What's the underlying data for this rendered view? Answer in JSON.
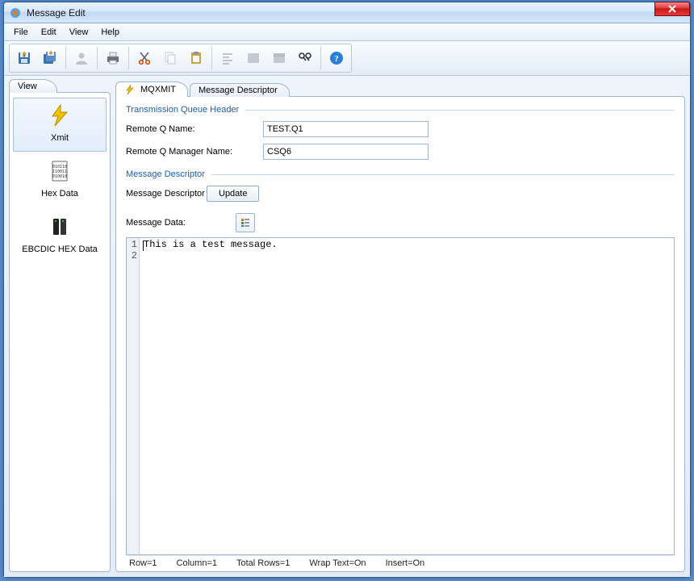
{
  "title": "Message Edit",
  "menu": {
    "file": "File",
    "edit": "Edit",
    "view": "View",
    "help": "Help"
  },
  "toolbar": {
    "save": "save-icon",
    "save_all": "save-all-icon",
    "user": "user-icon",
    "print": "print-icon",
    "cut": "cut-icon",
    "copy": "copy-icon",
    "paste": "paste-icon",
    "dedent": "dedent-icon",
    "block1": "block-icon",
    "block2": "block-icon",
    "find": "find-icon",
    "help": "help-icon"
  },
  "side": {
    "tab": "View",
    "items": [
      {
        "id": "xmit",
        "label": "Xmit"
      },
      {
        "id": "hex",
        "label": "Hex Data"
      },
      {
        "id": "ebcdic",
        "label": "EBCDIC HEX Data"
      }
    ]
  },
  "tabs": {
    "mqxmit": "MQXMIT",
    "msgdesc": "Message Descriptor"
  },
  "form": {
    "group1": "Transmission Queue Header",
    "remote_q_label": "Remote Q Name:",
    "remote_q_value": "TEST.Q1",
    "remote_qm_label": "Remote Q Manager Name:",
    "remote_qm_value": "CSQ6",
    "group2": "Message Descriptor",
    "md_label": "Message Descriptor",
    "update_btn": "Update",
    "msg_data_label": "Message Data:"
  },
  "editor": {
    "lines": [
      "1",
      "2"
    ],
    "text": "This is a test message."
  },
  "status": {
    "row": "Row=1",
    "col": "Column=1",
    "total": "Total Rows=1",
    "wrap": "Wrap Text=On",
    "insert": "Insert=On"
  }
}
